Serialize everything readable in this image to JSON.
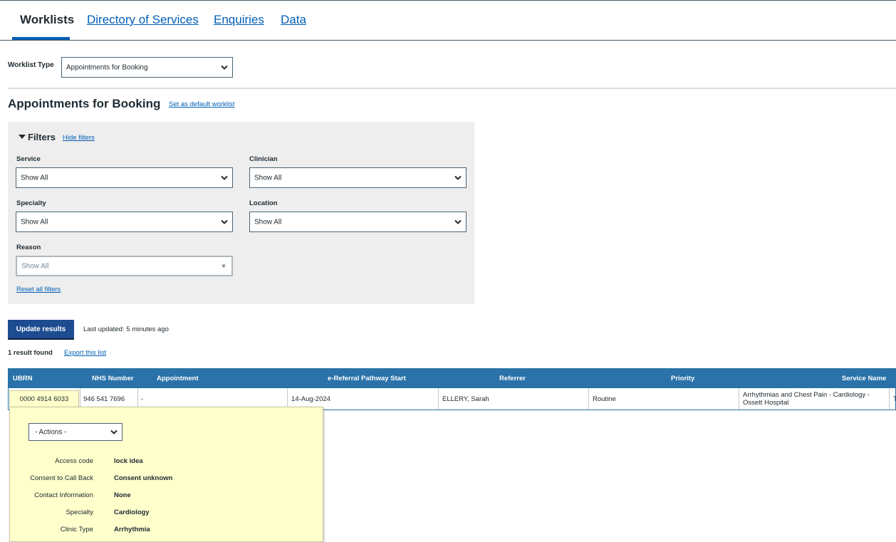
{
  "nav": {
    "tabs": [
      {
        "label": "Worklists",
        "active": true
      },
      {
        "label": "Directory of Services"
      },
      {
        "label": "Enquiries"
      },
      {
        "label": "Data"
      }
    ]
  },
  "worklist_type": {
    "label": "Worklist Type",
    "value": "Appointments for Booking"
  },
  "page": {
    "title": "Appointments for Booking",
    "default_link": "Set as default worklist"
  },
  "filters": {
    "title": "Filters",
    "hide_link": "Hide filters",
    "service": {
      "label": "Service",
      "value": "Show All"
    },
    "clinician": {
      "label": "Clinician",
      "value": "Show All"
    },
    "specialty": {
      "label": "Specialty",
      "value": "Show All"
    },
    "location": {
      "label": "Location",
      "value": "Show All"
    },
    "reason": {
      "label": "Reason",
      "value": "Show All"
    },
    "reset_link": "Reset all filters"
  },
  "actions": {
    "update_button": "Update results",
    "last_updated": "Last updated: 5 minutes ago",
    "result_count": "1 result found",
    "export_link": "Export this list"
  },
  "table": {
    "headers": [
      "UBRN",
      "NHS Number",
      "Appointment",
      "e-Referral Pathway Start",
      "Referrer",
      "Priority",
      "Service Name"
    ],
    "row": {
      "ubrn": "0000 4914 6033",
      "nhs_number": "946 541 7696",
      "appointment": "-",
      "pathway_start": "14-Aug-2024",
      "referrer": "ELLERY, Sarah",
      "priority": "Routine",
      "service_line1": "Arrhythmias and Chest Pain - Cardiology -",
      "service_line2": "Ossett Hospital",
      "overflow": "T"
    }
  },
  "popup": {
    "actions_select": "- Actions -",
    "details": [
      {
        "key": "Access code",
        "value": "lock idea"
      },
      {
        "key": "Consent to Call Back",
        "value": "Consent unknown"
      },
      {
        "key": "Contact Information",
        "value": "None"
      },
      {
        "key": "Specialty",
        "value": "Cardiology"
      },
      {
        "key": "Clinic Type",
        "value": "Arrhythmia"
      }
    ]
  },
  "colors": {
    "link": "#005eb8",
    "table_header": "#2a72a9",
    "button": "#1d4c91",
    "popup_bg": "#ffffcc",
    "filter_panel": "#eeeeee"
  }
}
